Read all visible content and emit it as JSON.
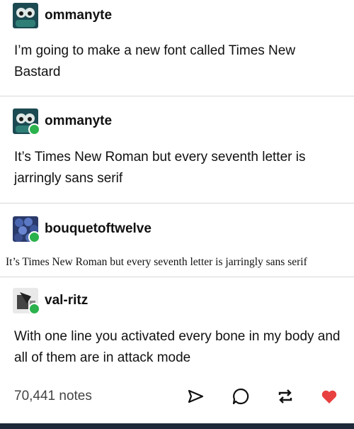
{
  "posts": [
    {
      "username": "ommanyte",
      "text": "I’m going to make a new font called Times New Bastard"
    },
    {
      "username": "ommanyte",
      "text": "It’s Times New Roman but every seventh letter is jarringly sans serif"
    },
    {
      "username": "bouquetoftwelve",
      "text": "It’s Times New Roman but every seventh letter is jarringly sans serif"
    },
    {
      "username": "val-ritz",
      "text": "With one line you activated every bone in my body and all of them are in attack mode"
    }
  ],
  "footer": {
    "notes_label": "70,441 notes",
    "icons": [
      "share-icon",
      "reply-icon",
      "reblog-icon",
      "like-heart-icon"
    ],
    "heart_color": "#e8403f",
    "reblog_badge_color": "#2bb24c"
  }
}
